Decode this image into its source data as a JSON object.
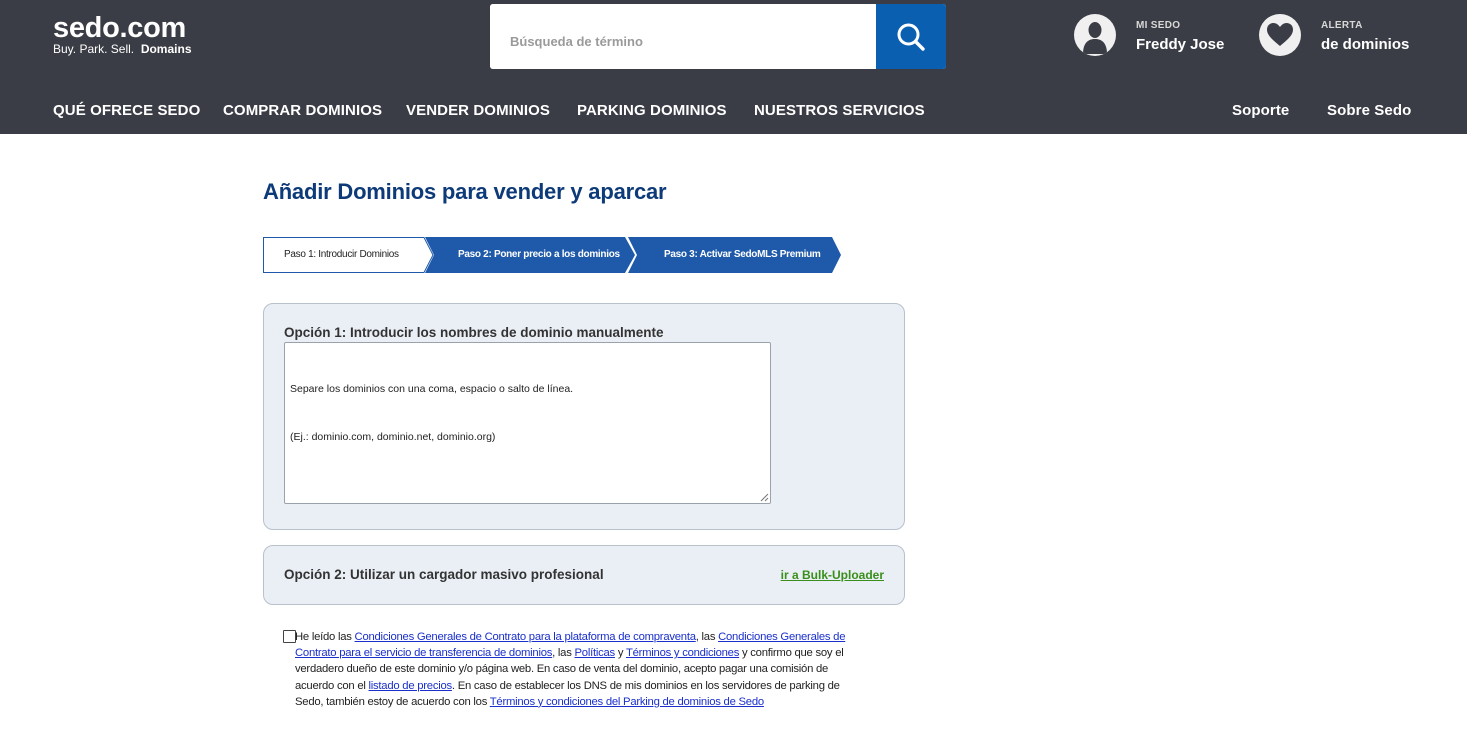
{
  "header": {
    "logo_main": "sedo.com",
    "logo_tagline": "Buy.  Park.  Sell.",
    "logo_tagline_bold": "Domains",
    "search_placeholder": "Búsqueda de término",
    "search_icon": "search-icon",
    "account": {
      "label": "MI SEDO",
      "name": "Freddy Jose",
      "icon": "user-icon"
    },
    "alert": {
      "label": "ALERTA",
      "value": "de dominios",
      "icon": "heart-icon"
    },
    "nav_left": [
      "QUÉ OFRECE SEDO",
      "COMPRAR DOMINIOS",
      "VENDER DOMINIOS",
      "PARKING DOMINIOS",
      "NUESTROS SERVICIOS"
    ],
    "nav_right": [
      "Soporte",
      "Sobre Sedo"
    ],
    "background_color": "#3a3d45",
    "accent_color": "#0a5fb0"
  },
  "page": {
    "title": "Añadir Dominios para vender y aparcar",
    "steps": [
      {
        "label": "Paso 1: Introducir Dominios",
        "active": false
      },
      {
        "label": "Paso 2: Poner precio a los dominios",
        "active": true
      },
      {
        "label": "Paso 3: Activar SedoMLS Premium",
        "active": true
      }
    ],
    "option1": {
      "title": "Opción 1: Introducir los nombres de dominio manualmente",
      "placeholder_line1": "Separe los dominios con una coma, espacio o salto de línea.",
      "placeholder_line2": "(Ej.: dominio.com, dominio.net, dominio.org)"
    },
    "option2": {
      "title": "Opción 2: Utilizar un cargador masivo profesional",
      "link": "ir a Bulk-Uploader"
    },
    "terms": {
      "t1": "He leído las ",
      "l1": "Condiciones Generales de Contrato para la plataforma de compraventa",
      "t2": ", las ",
      "l2": "Condiciones Generales de Contrato para el servicio de transferencia de dominios",
      "t3": ", las ",
      "l3": "Políticas",
      "t4": " y ",
      "l4": "Términos y condiciones",
      "t5": " y confirmo que soy el verdadero dueño de este dominio y/o página web. En caso de venta del dominio, acepto pagar una comisión de acuerdo con el ",
      "l5": "listado de precios",
      "t6": ". En caso de establecer los DNS de mis dominios en los servidores de parking de Sedo, también estoy de acuerdo con los ",
      "l6": "Términos y condiciones del Parking de dominios de Sedo"
    },
    "title_color": "#0d3a78",
    "step_color": "#1f5aaa",
    "link_color": "#1a2fcc",
    "bulk_link_color": "#3a8f1a"
  }
}
